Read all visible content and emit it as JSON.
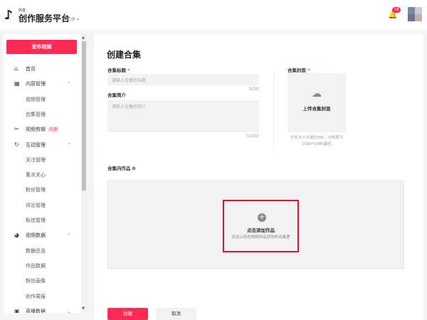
{
  "header": {
    "brand_small": "抖音",
    "brand": "创作服务平台",
    "switch": "切换 ▾",
    "notification_count": "18"
  },
  "sidebar": {
    "publish": "发布视频",
    "items": [
      {
        "label": "首页",
        "icon": "home-icon",
        "type": "main"
      },
      {
        "label": "内容管理",
        "icon": "content-icon",
        "type": "main",
        "chev": "^"
      },
      {
        "label": "视频管理",
        "type": "sub"
      },
      {
        "label": "合集管理",
        "type": "sub"
      },
      {
        "label": "视频剪辑",
        "icon": "scissors-icon",
        "type": "main",
        "tag": "内测"
      },
      {
        "label": "互动管理",
        "icon": "interaction-icon",
        "type": "main",
        "chev": "^"
      },
      {
        "label": "关注管理",
        "type": "sub"
      },
      {
        "label": "重点关心",
        "type": "sub"
      },
      {
        "label": "粉丝管理",
        "type": "sub"
      },
      {
        "label": "评论管理",
        "type": "sub"
      },
      {
        "label": "私信管理",
        "type": "sub"
      },
      {
        "label": "视频数据",
        "icon": "pie-chart-icon",
        "type": "main",
        "chev": "^"
      },
      {
        "label": "数据总览",
        "type": "sub"
      },
      {
        "label": "作品数据",
        "type": "sub"
      },
      {
        "label": "粉丝画像",
        "type": "sub"
      },
      {
        "label": "创作周报",
        "type": "sub"
      },
      {
        "label": "直播数据",
        "icon": "live-icon",
        "type": "main",
        "chev": "v"
      }
    ]
  },
  "main": {
    "title": "创建合集",
    "title_label": "合集标题",
    "required": "*",
    "title_placeholder": "请输入合集的标题",
    "title_count": "0/20",
    "intro_label": "合集简介",
    "intro_placeholder": "请输入合集的简介",
    "intro_count": "0/200",
    "cover_label": "合集封面",
    "cover_upload": "上传合集封面",
    "cover_hint": "文件大小不超过5M，分辨率为1080*1080最佳",
    "works_label": "合集内作品 0",
    "add_title": "点击添加作品",
    "add_sub": "添加上传的视频作品到你的合集里",
    "create": "创建",
    "cancel": "取消"
  },
  "colors": {
    "accent": "#fe2c55",
    "highlight": "#e8141b"
  }
}
